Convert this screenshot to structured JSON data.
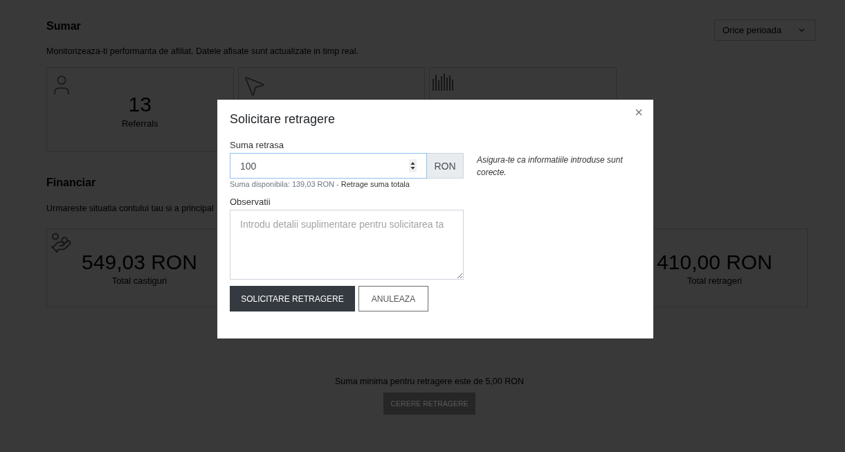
{
  "summary": {
    "title": "Sumar",
    "period": {
      "value": "Orice perioada"
    },
    "description": "Monitorizeaza-ti performanta de afiliat. Datele afisate sunt actualizate in timp real.",
    "cards": [
      {
        "kind": "user",
        "value": "13",
        "label": "Referrals"
      },
      {
        "kind": "cursor"
      },
      {
        "kind": "chart"
      }
    ]
  },
  "financial": {
    "title": "Financiar",
    "description": "Urmareste situatia contului tau si a principal",
    "cards": [
      {
        "kind": "money",
        "value": "549,03 RON",
        "label": "Total castiguri"
      },
      {
        "kind": "plain",
        "value": "410,00 RON",
        "label": "Total retrageri"
      }
    ],
    "minimum_note": "Suma minima pentru retragere este de 5,00 RON",
    "request_button": "CERERE RETRAGERE"
  },
  "dialog": {
    "title": "Solicitare retragere",
    "close": "×",
    "amount": {
      "label": "Suma retrasa",
      "value": "100",
      "focused": true,
      "unit": "RON",
      "help": "Suma disponibila: 139,03 RON -",
      "help_link": "Retrage suma totala"
    },
    "notes": {
      "label": "Observatii",
      "placeholder": "Introdu detalii suplimentare pentru solicitarea ta"
    },
    "hint": "Asigura-te ca informatiile introduse sunt corecte.",
    "buttons": [
      {
        "kind": "primary",
        "label": "SOLICITARE RETRAGERE"
      },
      {
        "kind": "secondary",
        "label": "ANULEAZA"
      }
    ]
  }
}
